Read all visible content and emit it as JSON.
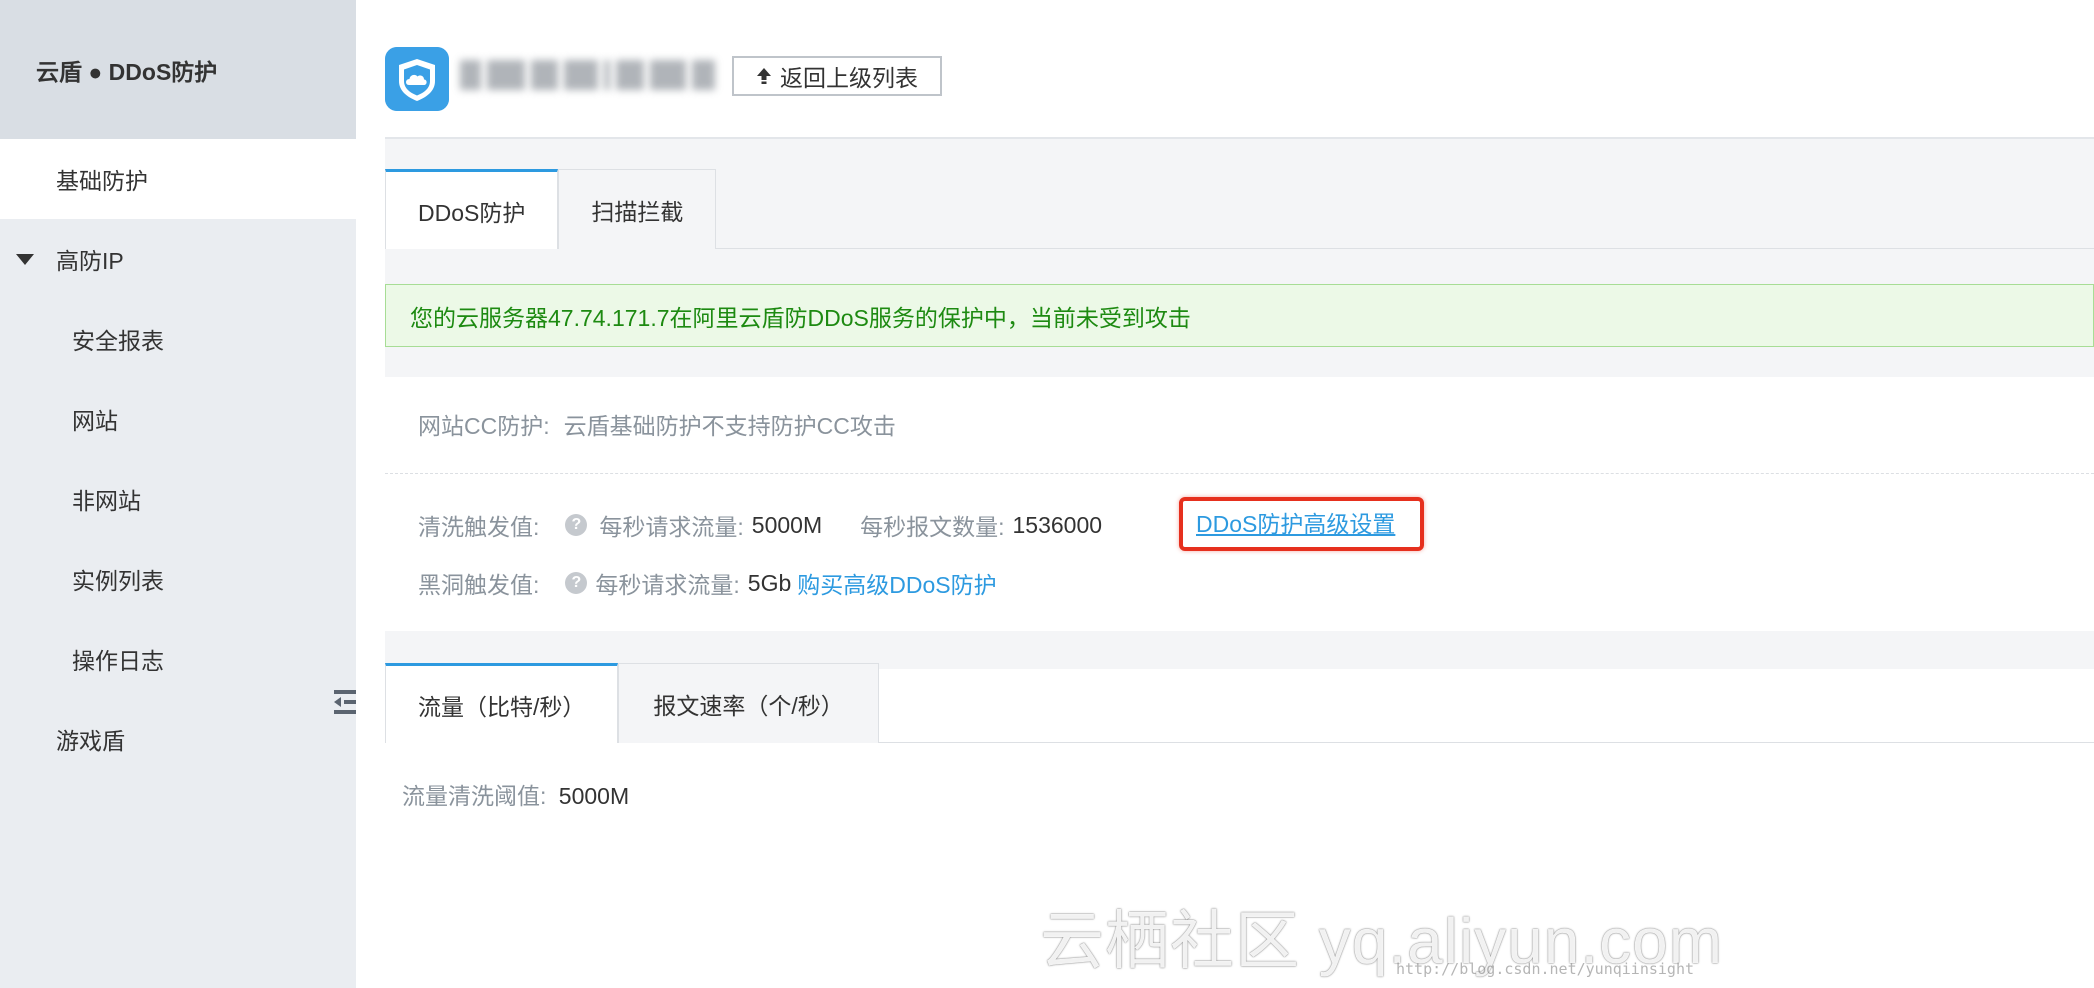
{
  "sidebar": {
    "title": "云盾 ● DDoS防护",
    "items": [
      {
        "label": "基础防护",
        "active": true
      },
      {
        "label": "高防IP",
        "expanded": true
      },
      {
        "label": "安全报表"
      },
      {
        "label": "网站"
      },
      {
        "label": "非网站"
      },
      {
        "label": "实例列表"
      },
      {
        "label": "操作日志"
      },
      {
        "label": "游戏盾"
      }
    ]
  },
  "header": {
    "icon": "shield-cloud-icon",
    "back_button": "返回上级列表"
  },
  "tabs_top": [
    {
      "label": "DDoS防护",
      "active": true
    },
    {
      "label": "扫描拦截",
      "active": false
    }
  ],
  "alert": {
    "text": "您的云服务器47.74.171.7在阿里云盾防DDoS服务的保护中，当前未受到攻击"
  },
  "info": {
    "cc_label": "网站CC防护:",
    "cc_value": "云盾基础防护不支持防护CC攻击",
    "clean_label": "清洗触发值:",
    "clean_req_label": "每秒请求流量:",
    "clean_req_value": "5000M",
    "clean_pkt_label": "每秒报文数量:",
    "clean_pkt_value": "1536000",
    "advanced_link": "DDoS防护高级设置",
    "blackhole_label": "黑洞触发值:",
    "blackhole_req_label": "每秒请求流量:",
    "blackhole_req_value": "5Gb",
    "buy_link": "购买高级DDoS防护"
  },
  "tabs_chart": [
    {
      "label": "流量（比特/秒）",
      "active": true
    },
    {
      "label": "报文速率（个/秒）",
      "active": false
    }
  ],
  "threshold": {
    "label": "流量清洗阈值:",
    "value": "5000M"
  },
  "watermark": {
    "main": "云栖社区 yq.aliyun.com",
    "csdn": "http://blog.csdn.net/yunqiinsight"
  },
  "colors": {
    "accent": "#2d9ae0",
    "success_text": "#1d8a11",
    "highlight_border": "#e6301e"
  }
}
